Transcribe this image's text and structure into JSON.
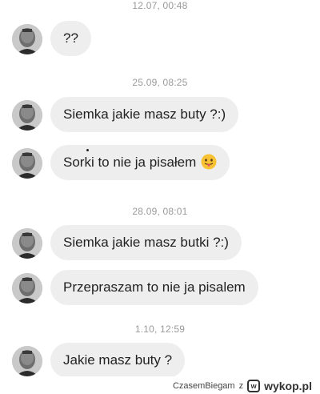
{
  "conversation": {
    "timestamps": [
      "12.07, 00:48",
      "25.09, 08:25",
      "28.09, 08:01",
      "1.10, 12:59"
    ],
    "messages": [
      {
        "text": "??"
      },
      {
        "text": "Siemka jakie masz buty ?:)"
      },
      {
        "text": "Sorki to nie ja pisałem",
        "emoji": "tongue-out-emoji"
      },
      {
        "text": "Siemka jakie masz butki ?:)"
      },
      {
        "text": "Przepraszam to nie ja pisalem"
      },
      {
        "text": "Jakie masz buty ?"
      }
    ]
  },
  "footer": {
    "author": "CzasemBiegam",
    "connector": "z",
    "brand": "wykop.pl",
    "logo_icon": "wykop-logo-icon"
  },
  "colors": {
    "bubble": "#eeeeef",
    "timestamp": "#9a9a9a",
    "text": "#222222"
  }
}
